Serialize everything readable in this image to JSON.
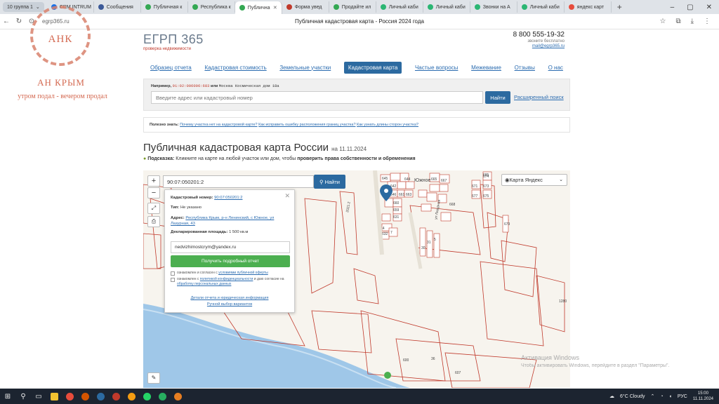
{
  "browser": {
    "tab_group": "10 группа 1",
    "tabs": [
      {
        "label": "CRM INTRUM",
        "color": "#1a73e8"
      },
      {
        "label": "Сообщения",
        "color": "#3b5998"
      },
      {
        "label": "Публичная к",
        "color": "#34a853"
      },
      {
        "label": "Республика к",
        "color": "#34a853"
      },
      {
        "label": "Публична",
        "color": "#34a853",
        "active": true
      },
      {
        "label": "Форма увед",
        "color": "#c0392b"
      },
      {
        "label": "Продайте ил",
        "color": "#34a853"
      },
      {
        "label": "Личный каби",
        "color": "#2bb673"
      },
      {
        "label": "Личный каби",
        "color": "#2bb673"
      },
      {
        "label": "Звонки на А",
        "color": "#2bb673"
      },
      {
        "label": "Личный каби",
        "color": "#2bb673"
      },
      {
        "label": "яндекс карт",
        "color": "#e74c3c"
      }
    ],
    "url": "egrp365.ru",
    "page_title": "Публичная кадастровая карта - Россия 2024 года"
  },
  "watermark": {
    "initials": "АНК",
    "name": "АН КРЫМ",
    "slogan": "утром подал - вечером продал"
  },
  "site": {
    "logo": "ЕГРП 365",
    "logo_sub": "проверка недвижимости",
    "phone": "8 800 555-19-32",
    "phone_note": "звоните бесплатно",
    "email": "mail@egrp365.ru",
    "nav": [
      {
        "label": "Образец отчета"
      },
      {
        "label": "Кадастровая стоимость"
      },
      {
        "label": "Земельные участки"
      },
      {
        "label": "Кадастровая карта",
        "active": true
      },
      {
        "label": "Частые вопросы"
      },
      {
        "label": "Межевание"
      },
      {
        "label": "Отзывы"
      },
      {
        "label": "О нас"
      }
    ],
    "search": {
      "example_prefix": "Например,",
      "example_code": "91:02:006006:683",
      "example_or": "или",
      "example_addr": "Москва Космическая дом 18а",
      "placeholder": "Введите адрес или кадастровый номер",
      "button": "Найти",
      "advanced": "Расширенный поиск"
    },
    "useful": {
      "label": "Полезно знать:",
      "links": [
        "Почему участка нет на кадастровой карте?",
        "Как исправить ошибку расположения границ участка?",
        "Как узнать длины сторон участка?"
      ]
    },
    "heading": "Публичная кадастровая карта России",
    "heading_date": "на 11.11.2024",
    "hint_label": "Подсказка:",
    "hint_text": "Кликните на карте на любой участок или дом, чтобы",
    "hint_bold": "проверить права собственности и обременения"
  },
  "map": {
    "search_value": "90:07:050201:2",
    "find_button": "Найти",
    "zoom_in": "+",
    "zoom_out": "−",
    "layer": "Карта Яндекс",
    "village_label": "Южное",
    "popup": {
      "cad_label": "Кадастровый номер:",
      "cad_value": "90:07:050201:2",
      "type_label": "Тип:",
      "type_value": "Не указано",
      "addr_label": "Адрес:",
      "addr_value": "Республика Крым, р-н Ленинский, с Южное, ул Лазурная, 43",
      "area_label": "Декларированная площадь:",
      "area_value": "1 500 кв.м",
      "email_value": "nedvizhimostcrym@yandex.ru",
      "report_button": "Получить подробный отчет",
      "check1_pre": "ознакомлен и согласен с",
      "check1_link": "условиями публичной оферты",
      "check2_pre": "ознакомлен с",
      "check2_link": "политикой конфиденциальности",
      "check2_mid": "и даю согласие на",
      "check2_link2": "обработку персональных данных",
      "link1": "Детали отчета и юридическая информация",
      "link2": "Ручной выбор вариантов"
    },
    "parcel_labels": [
      "645",
      "642",
      "644",
      "646",
      "661",
      "663",
      "665",
      "667",
      "668",
      "660",
      "659",
      "631",
      "632",
      "674",
      "671",
      "673",
      "677",
      "675",
      "679",
      "14",
      "7",
      "5",
      "31",
      "30",
      "36",
      "600",
      "607",
      "1280",
      "685",
      "2021.2",
      "ул Лазурная"
    ],
    "activate_title": "Активация Windows",
    "activate_sub": "Чтобы активировать Windows, перейдите в раздел \"Параметры\"."
  },
  "taskbar": {
    "weather": "6°C Cloudy",
    "lang": "РУС",
    "time": "15:00",
    "date": "11.11.2024"
  }
}
